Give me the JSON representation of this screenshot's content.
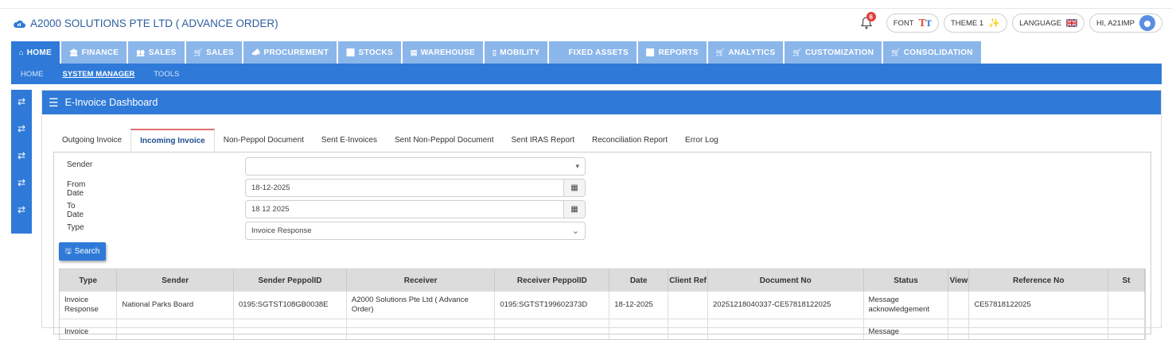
{
  "app": {
    "title": "A2000 SOLUTIONS PTE LTD ( ADVANCE ORDER)",
    "notifications_count": "6",
    "font_label": "FONT",
    "theme_label": "THEME 1",
    "language_label": "LANGUAGE",
    "user_label": "HI, A21IMP"
  },
  "nav": {
    "items": [
      {
        "label": "HOME",
        "icon": "home-icon"
      },
      {
        "label": "FINANCE",
        "icon": "bank-icon"
      },
      {
        "label": "SALES",
        "icon": "users-icon"
      },
      {
        "label": "SALES",
        "icon": "cart-icon"
      },
      {
        "label": "PROCUREMENT",
        "icon": "megaphone-icon"
      },
      {
        "label": "STOCKS",
        "icon": "bar-chart-icon"
      },
      {
        "label": "WAREHOUSE",
        "icon": "archive-icon"
      },
      {
        "label": "MOBILITY",
        "icon": "mobile-icon"
      },
      {
        "label": "FIXED ASSETS",
        "icon": ""
      },
      {
        "label": "REPORTS",
        "icon": "bar-chart-icon"
      },
      {
        "label": "ANALYTICS",
        "icon": "cart-icon"
      },
      {
        "label": "CUSTOMIZATION",
        "icon": "cart-icon"
      },
      {
        "label": "CONSOLIDATION",
        "icon": "cart-icon"
      }
    ]
  },
  "subnav": {
    "items": [
      "HOME",
      "SYSTEM MANAGER",
      "TOOLS"
    ]
  },
  "panel": {
    "title": "E-Invoice Dashboard"
  },
  "tabs": [
    "Outgoing Invoice",
    "Incoming Invoice",
    "Non-Peppol Document",
    "Sent E-Invoices",
    "Sent Non-Peppol Document",
    "Sent IRAS Report",
    "Reconciliation Report",
    "Error Log"
  ],
  "form": {
    "sender_label": "Sender",
    "sender_value": "",
    "from_date_label": "From Date",
    "from_date_value": "18-12-2025",
    "to_date_label": "To Date",
    "to_date_value": "18 12 2025",
    "type_label": "Type",
    "type_value": "Invoice Response",
    "search_label": "Search"
  },
  "table": {
    "columns": [
      "Type",
      "Sender",
      "Sender PeppolID",
      "Receiver",
      "Receiver PeppolID",
      "Date",
      "Client Ref",
      "Document No",
      "Status",
      "View",
      "Reference No",
      "St"
    ],
    "rows": [
      [
        "Invoice Response",
        "National Parks Board",
        "0195:SGTST108GB0038E",
        "A2000 Solutions Pte Ltd ( Advance Order)",
        "0195:SGTST199602373D",
        "18-12-2025",
        "",
        "20251218040337-CE57818122025",
        "Message acknowledgement",
        "",
        "CE57818122025",
        ""
      ],
      [
        "Invoice",
        "",
        "",
        "",
        "",
        "",
        "",
        "",
        "Message",
        "",
        "",
        ""
      ]
    ]
  },
  "colors": {
    "primary": "#2f7ad8",
    "nav_inactive": "#8bb6ea",
    "badge": "#e23d3d"
  }
}
